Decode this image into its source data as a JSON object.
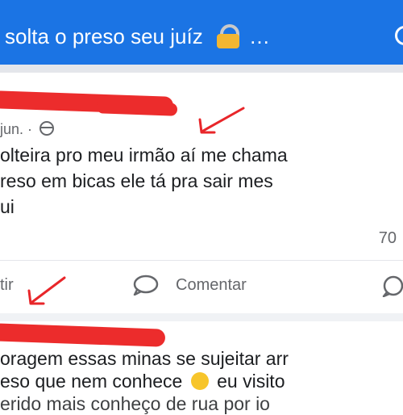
{
  "header": {
    "title": "solta o preso seu juíz",
    "ellipsis": "...",
    "background": "#1b74e4"
  },
  "post1": {
    "date": "jun.",
    "lines": [
      "olteira pro meu irmão aí me chama",
      "reso em bicas ele tá pra sair mes",
      "ui"
    ],
    "reaction_count": "70",
    "actions": {
      "share_partial": "tir",
      "comment": "Comentar"
    }
  },
  "post2": {
    "line1": "oragem essas minas se sujeitar arr",
    "line2_before": "eso que nem conhece",
    "line2_after": "eu visito",
    "line3": "erido mais conheço de rua por io"
  },
  "colors": {
    "redaction": "#ec2c2c",
    "annotation_arrow": "#e8262a",
    "muted_text": "#65676b"
  },
  "icons": [
    "lock-icon",
    "search-icon",
    "globe-icon",
    "comment-icon",
    "whatsapp-icon",
    "laughing-emoji-icon"
  ]
}
